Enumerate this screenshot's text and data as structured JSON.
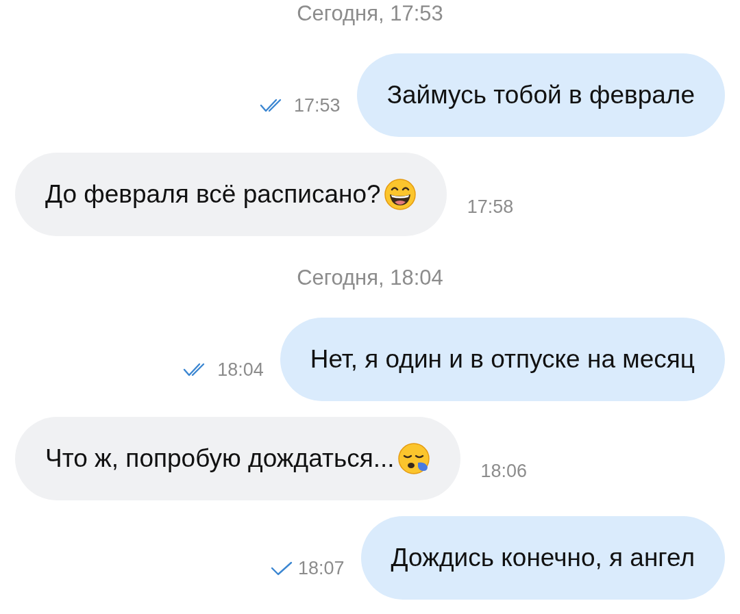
{
  "messages": [
    {
      "kind": "date",
      "text": "Сегодня, 17:53"
    },
    {
      "kind": "outgoing",
      "text": "Займусь тобой в феврале",
      "time": "17:53",
      "read": true
    },
    {
      "kind": "incoming",
      "text": "До февраля всё расписано?",
      "emoji": {
        "kind": "grinning"
      },
      "time": "17:58"
    },
    {
      "kind": "date",
      "text": "Сегодня, 18:04"
    },
    {
      "kind": "outgoing",
      "text": "Нет, я один и в отпуске на месяц",
      "time": "18:04",
      "read": true
    },
    {
      "kind": "incoming",
      "text": "Что ж, попробую дождаться...",
      "emoji": {
        "kind": "sleepy"
      },
      "time": "18:06"
    },
    {
      "kind": "outgoing",
      "text": "Дождись конечно, я ангел",
      "time": "18:07",
      "read": false
    }
  ]
}
